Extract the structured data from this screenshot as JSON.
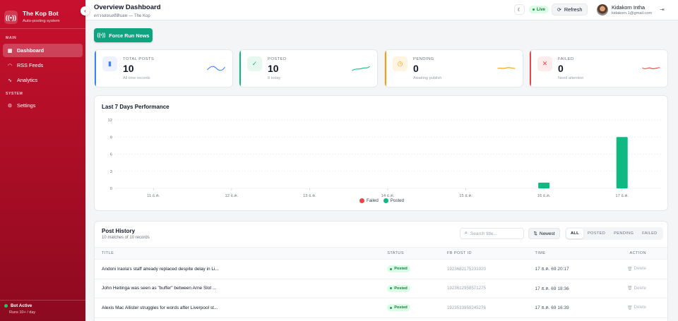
{
  "sidebar": {
    "brand_icon": "((•))",
    "brand_name": "The Kop Bot",
    "brand_sub": "Auto-posting system",
    "collapse_icon": "‹",
    "sections": {
      "main_label": "MAIN",
      "system_label": "SYSTEM"
    },
    "items": [
      {
        "label": "Dashboard",
        "icon": "grid-icon",
        "glyph": "▦"
      },
      {
        "label": "RSS Feeds",
        "icon": "rss-icon",
        "glyph": "◠"
      },
      {
        "label": "Analytics",
        "icon": "activity-icon",
        "glyph": "∿"
      },
      {
        "label": "Settings",
        "icon": "gear-icon",
        "glyph": "⚙"
      }
    ],
    "bot_status": {
      "title": "Bot Active",
      "sub": "Runs 10+ / day",
      "color": "#22c55e"
    }
  },
  "header": {
    "title": "Overview Dashboard",
    "subtitle": "ตรวจสอบสถิติบอท — The Kop",
    "theme_icon": "☾",
    "live_label": "Live",
    "refresh_icon": "⟳",
    "refresh_label": "Refresh",
    "user_name": "Kidakorn Intha",
    "user_email": "kidakorn.1@gmail.com",
    "logout_icon": "⇥"
  },
  "force_run": {
    "icon": "((•))",
    "label": "Force Run News"
  },
  "stats": [
    {
      "label": "TOTAL POSTS",
      "value": "10",
      "sub": "All time records",
      "color": "#3b82f6",
      "icon": "bar-chart-icon",
      "glyph": "▮",
      "icon_bg": "#eef2ff"
    },
    {
      "label": "POSTED",
      "value": "10",
      "sub": "8 today",
      "color": "#10b981",
      "icon": "check-circle-icon",
      "glyph": "✓",
      "icon_bg": "#e7f8f0"
    },
    {
      "label": "PENDING",
      "value": "0",
      "sub": "Awaiting publish",
      "color": "#f59e0b",
      "icon": "clock-icon",
      "glyph": "◷",
      "icon_bg": "#fff4e0"
    },
    {
      "label": "FAILED",
      "value": "0",
      "sub": "Need attention",
      "color": "#ef4444",
      "icon": "x-circle-icon",
      "glyph": "✕",
      "icon_bg": "#fdecec"
    }
  ],
  "chart_card": {
    "title": "Last 7 Days Performance"
  },
  "chart_data": {
    "type": "bar",
    "categories": [
      "11 ธ.ค.",
      "12 ธ.ค.",
      "13 ธ.ค.",
      "14 ธ.ค.",
      "15 ธ.ค.",
      "16 ธ.ค.",
      "17 ธ.ค."
    ],
    "series": [
      {
        "name": "Failed",
        "color": "#ef4444",
        "values": [
          0,
          0,
          0,
          0,
          0,
          0,
          0
        ]
      },
      {
        "name": "Posted",
        "color": "#10b981",
        "values": [
          0,
          0,
          0,
          0,
          0,
          1,
          9
        ]
      }
    ],
    "yticks": [
      0,
      3,
      6,
      9,
      12
    ],
    "ylim": [
      0,
      12
    ],
    "grid": true,
    "legend_position": "bottom"
  },
  "history": {
    "title": "Post History",
    "subtitle": "10 matches of 10 records",
    "search_placeholder": "Search title...",
    "sort_icon": "⇅",
    "sort_label": "Newest",
    "filters": [
      "ALL",
      "POSTED",
      "PENDING",
      "FAILED"
    ],
    "active_filter": "ALL",
    "columns": [
      "TITLE",
      "STATUS",
      "FB POST ID",
      "TIME",
      "ACTION"
    ],
    "rows": [
      {
        "title": "Andoni Iraola's staff already replaced despite delay in Li...",
        "status": "Posted",
        "fb_id": "1923682175231020",
        "time": "17 ธ.ค. 69 20:17",
        "action": "Delete"
      },
      {
        "title": "John Heitinga was seen as \"buffer\" between Arne Slot ...",
        "status": "Posted",
        "fb_id": "1923612958571275",
        "time": "17 ธ.ค. 69 18:36",
        "action": "Delete"
      },
      {
        "title": "Alexis Mac Allister struggles for words after Liverpool st...",
        "status": "Posted",
        "fb_id": "1923533959245276",
        "time": "17 ธ.ค. 69 16:39",
        "action": "Delete"
      }
    ],
    "status_color": "#16a34a",
    "delete_icon": "trash-icon"
  }
}
